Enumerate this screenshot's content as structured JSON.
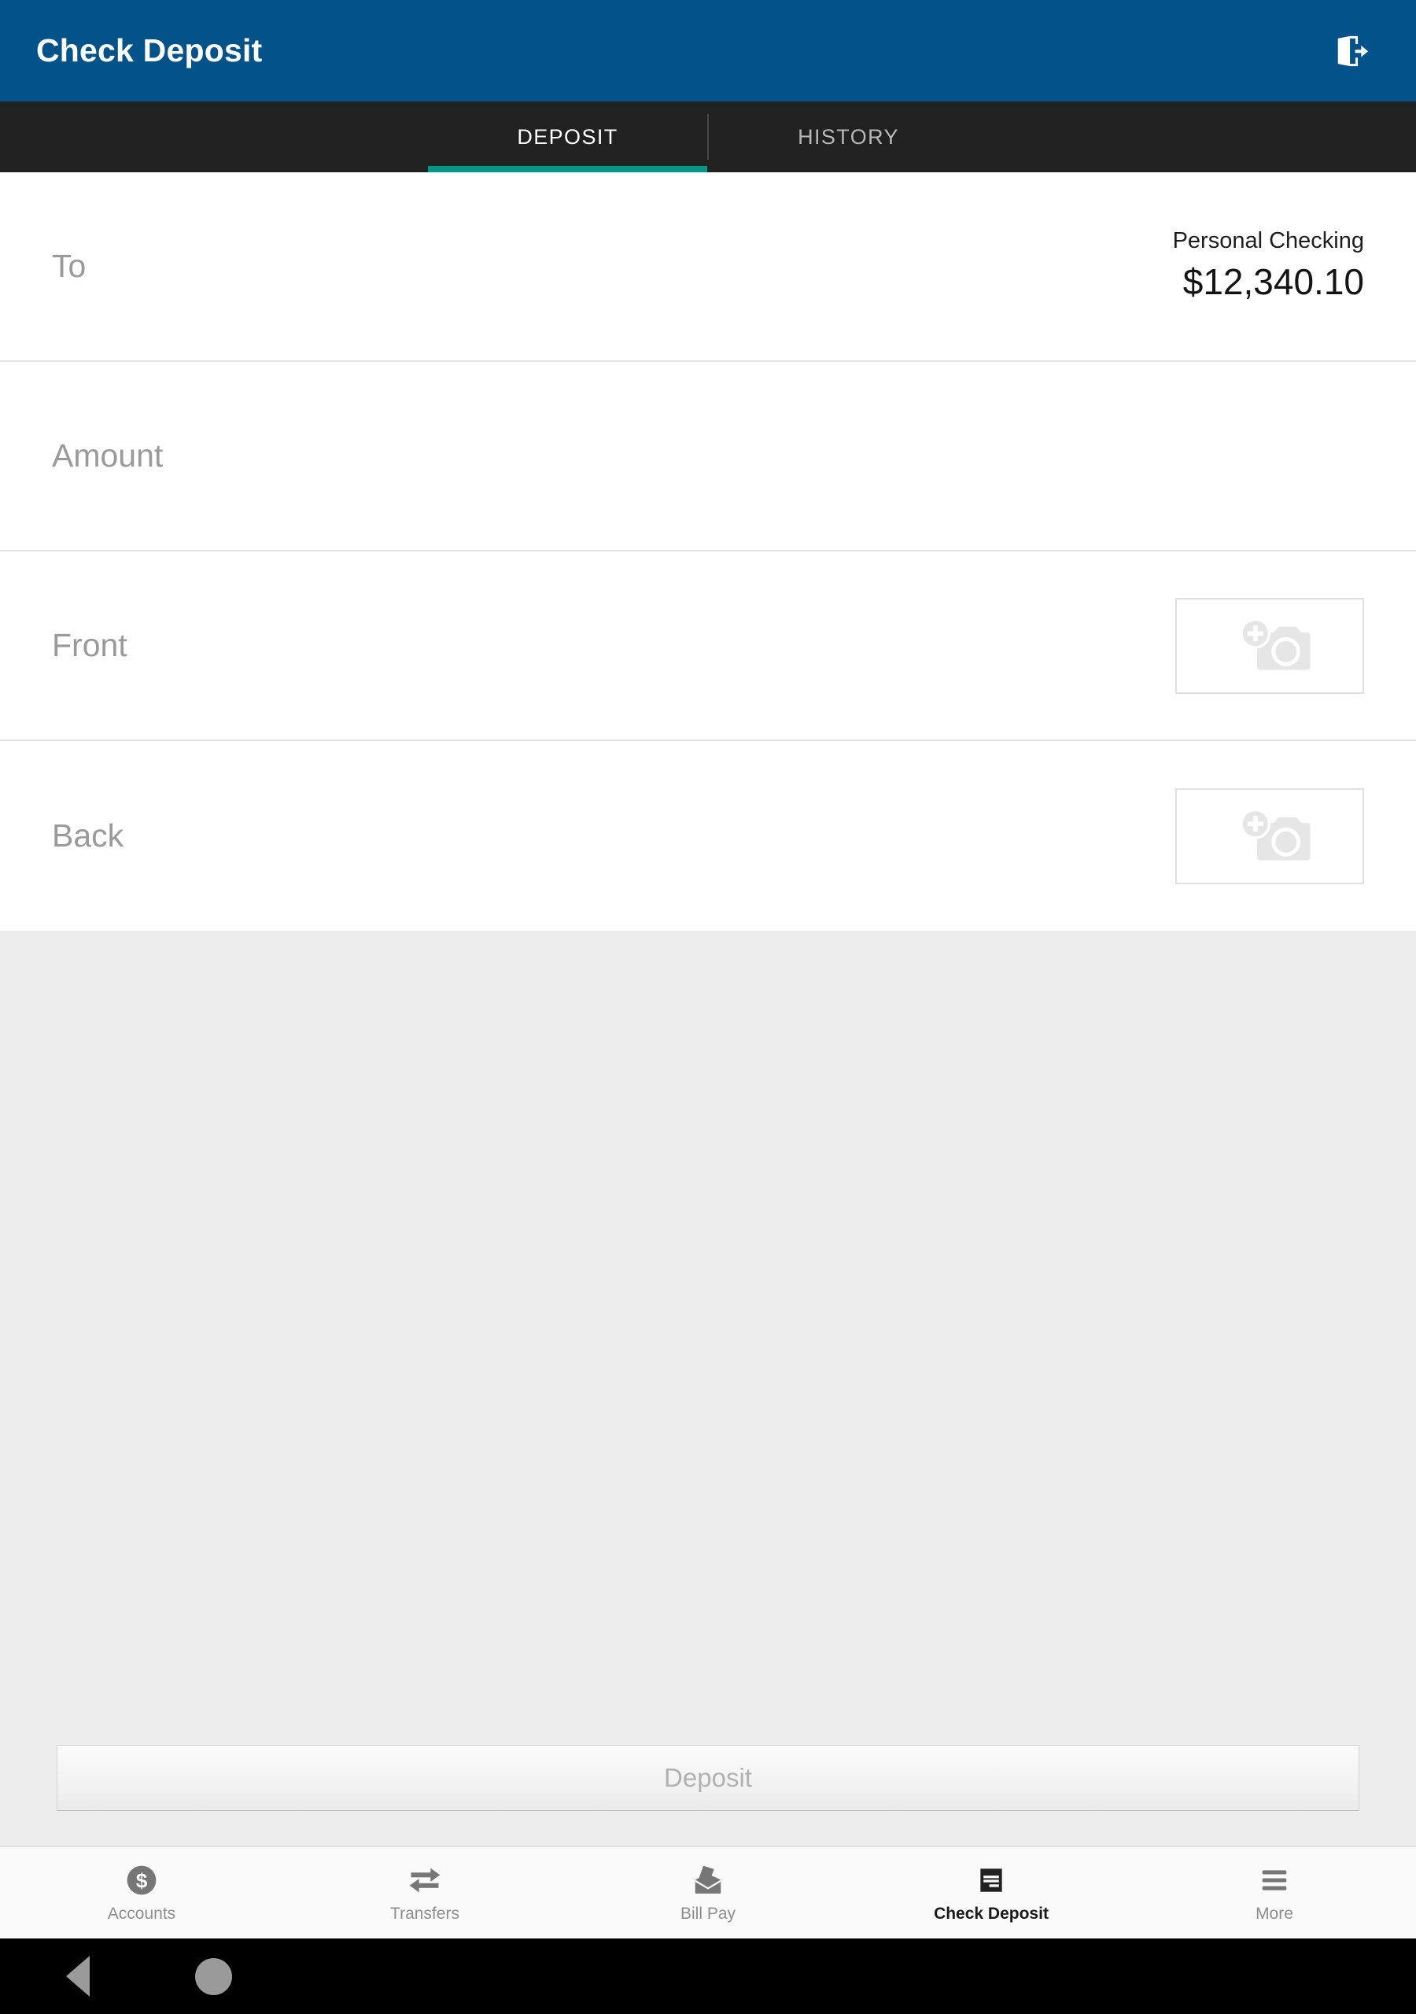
{
  "appbar": {
    "title": "Check Deposit",
    "logout_icon": "logout-icon",
    "background_color": "#03528a"
  },
  "tabs": [
    {
      "label": "DEPOSIT",
      "active": true
    },
    {
      "label": "HISTORY",
      "active": false
    }
  ],
  "tab_accent_color": "#009688",
  "form": {
    "to": {
      "label": "To",
      "account_name": "Personal Checking",
      "account_balance": "$12,340.10"
    },
    "amount": {
      "label": "Amount",
      "value": "",
      "placeholder": "Amount"
    },
    "front": {
      "label": "Front",
      "camera_icon": "add-photo-camera-icon"
    },
    "back": {
      "label": "Back",
      "camera_icon": "add-photo-camera-icon"
    }
  },
  "actions": {
    "deposit_label": "Deposit",
    "deposit_enabled": false
  },
  "bottom_nav": [
    {
      "label": "Accounts",
      "icon": "dollar-circle-icon",
      "active": false
    },
    {
      "label": "Transfers",
      "icon": "transfer-arrows-icon",
      "active": false
    },
    {
      "label": "Bill Pay",
      "icon": "envelope-icon",
      "active": false
    },
    {
      "label": "Check Deposit",
      "icon": "check-icon",
      "active": true
    },
    {
      "label": "More",
      "icon": "hamburger-icon",
      "active": false
    }
  ],
  "system_nav": {
    "back_icon": "back-triangle-icon",
    "home_icon": "home-circle-icon"
  }
}
